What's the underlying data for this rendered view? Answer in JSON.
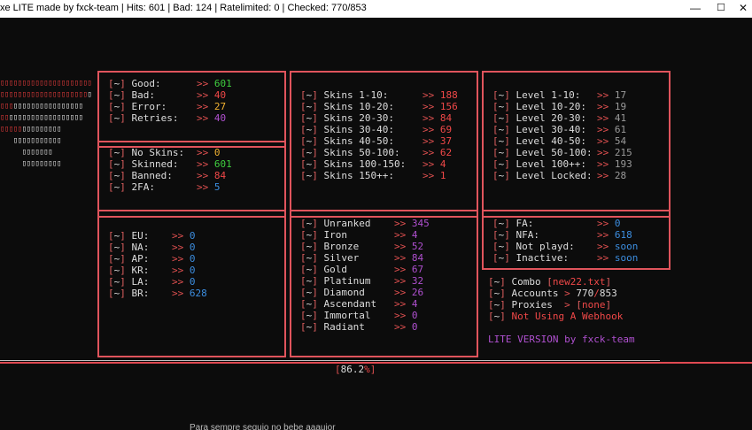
{
  "window": {
    "title": "xe LITE made by fxck-team | Hits: 601 | Bad: 124 | Ratelimited: 0 | Checked: 770/853",
    "minimize_glyph": "—",
    "maximize_glyph": "☐",
    "close_glyph": "✕"
  },
  "colors": {
    "border": "#e0545c",
    "background": "#0c0c0c"
  },
  "status": [
    {
      "label": "Good:",
      "value": "601",
      "color": "green"
    },
    {
      "label": "Bad:",
      "value": "40",
      "color": "red"
    },
    {
      "label": "Error:",
      "value": "27",
      "color": "yellow"
    },
    {
      "label": "Retries:",
      "value": "40",
      "color": "purple"
    }
  ],
  "skins_state": [
    {
      "label": "No Skins:",
      "value": "0",
      "color": "yellow"
    },
    {
      "label": "Skinned:",
      "value": "601",
      "color": "green"
    },
    {
      "label": "Banned:",
      "value": "84",
      "color": "red"
    },
    {
      "label": "2FA:",
      "value": "5",
      "color": "blue"
    }
  ],
  "skins": [
    {
      "label": "Skins 1-10:",
      "value": "188"
    },
    {
      "label": "Skins 10-20:",
      "value": "156"
    },
    {
      "label": "Skins 20-30:",
      "value": "84"
    },
    {
      "label": "Skins 30-40:",
      "value": "69"
    },
    {
      "label": "Skins 40-50:",
      "value": "37"
    },
    {
      "label": "Skins 50-100:",
      "value": "62"
    },
    {
      "label": "Skins 100-150:",
      "value": "4"
    },
    {
      "label": "Skins 150++:",
      "value": "1"
    }
  ],
  "levels": [
    {
      "label": "Level 1-10:",
      "value": "17"
    },
    {
      "label": "Level 10-20:",
      "value": "19"
    },
    {
      "label": "Level 20-30:",
      "value": "41"
    },
    {
      "label": "Level 30-40:",
      "value": "61"
    },
    {
      "label": "Level 40-50:",
      "value": "54"
    },
    {
      "label": "Level 50-100:",
      "value": "215"
    },
    {
      "label": "Level 100++:",
      "value": "193"
    },
    {
      "label": "Level Locked:",
      "value": "28"
    }
  ],
  "regions": [
    {
      "label": "EU:",
      "value": "0"
    },
    {
      "label": "NA:",
      "value": "0"
    },
    {
      "label": "AP:",
      "value": "0"
    },
    {
      "label": "KR:",
      "value": "0"
    },
    {
      "label": "LA:",
      "value": "0"
    },
    {
      "label": "BR:",
      "value": "628"
    }
  ],
  "ranks": [
    {
      "label": "Unranked",
      "value": "345"
    },
    {
      "label": "Iron",
      "value": "4"
    },
    {
      "label": "Bronze",
      "value": "52"
    },
    {
      "label": "Silver",
      "value": "84"
    },
    {
      "label": "Gold",
      "value": "67"
    },
    {
      "label": "Platinum",
      "value": "32"
    },
    {
      "label": "Diamond",
      "value": "26"
    },
    {
      "label": "Ascendant",
      "value": "4"
    },
    {
      "label": "Immortal",
      "value": "0"
    },
    {
      "label": "Radiant",
      "value": "0"
    }
  ],
  "access": [
    {
      "label": "FA:",
      "value": "0"
    },
    {
      "label": "NFA:",
      "value": "618"
    },
    {
      "label": "Not playd:",
      "value": "soon"
    },
    {
      "label": "Inactive:",
      "value": "soon"
    }
  ],
  "info": {
    "combo_label": "Combo",
    "combo_value": "new22.txt",
    "accounts_label": "Accounts",
    "accounts_checked": "770",
    "accounts_total": "853",
    "proxies_label": "Proxies",
    "proxies_value": "none",
    "webhook": "Not Using A Webhook",
    "version": "LITE VERSION by fxck-team"
  },
  "progress": {
    "percent": "86.2",
    "percent_sign": "%"
  },
  "cutoff_text": "Para sempre sequio no bebe aaauior"
}
